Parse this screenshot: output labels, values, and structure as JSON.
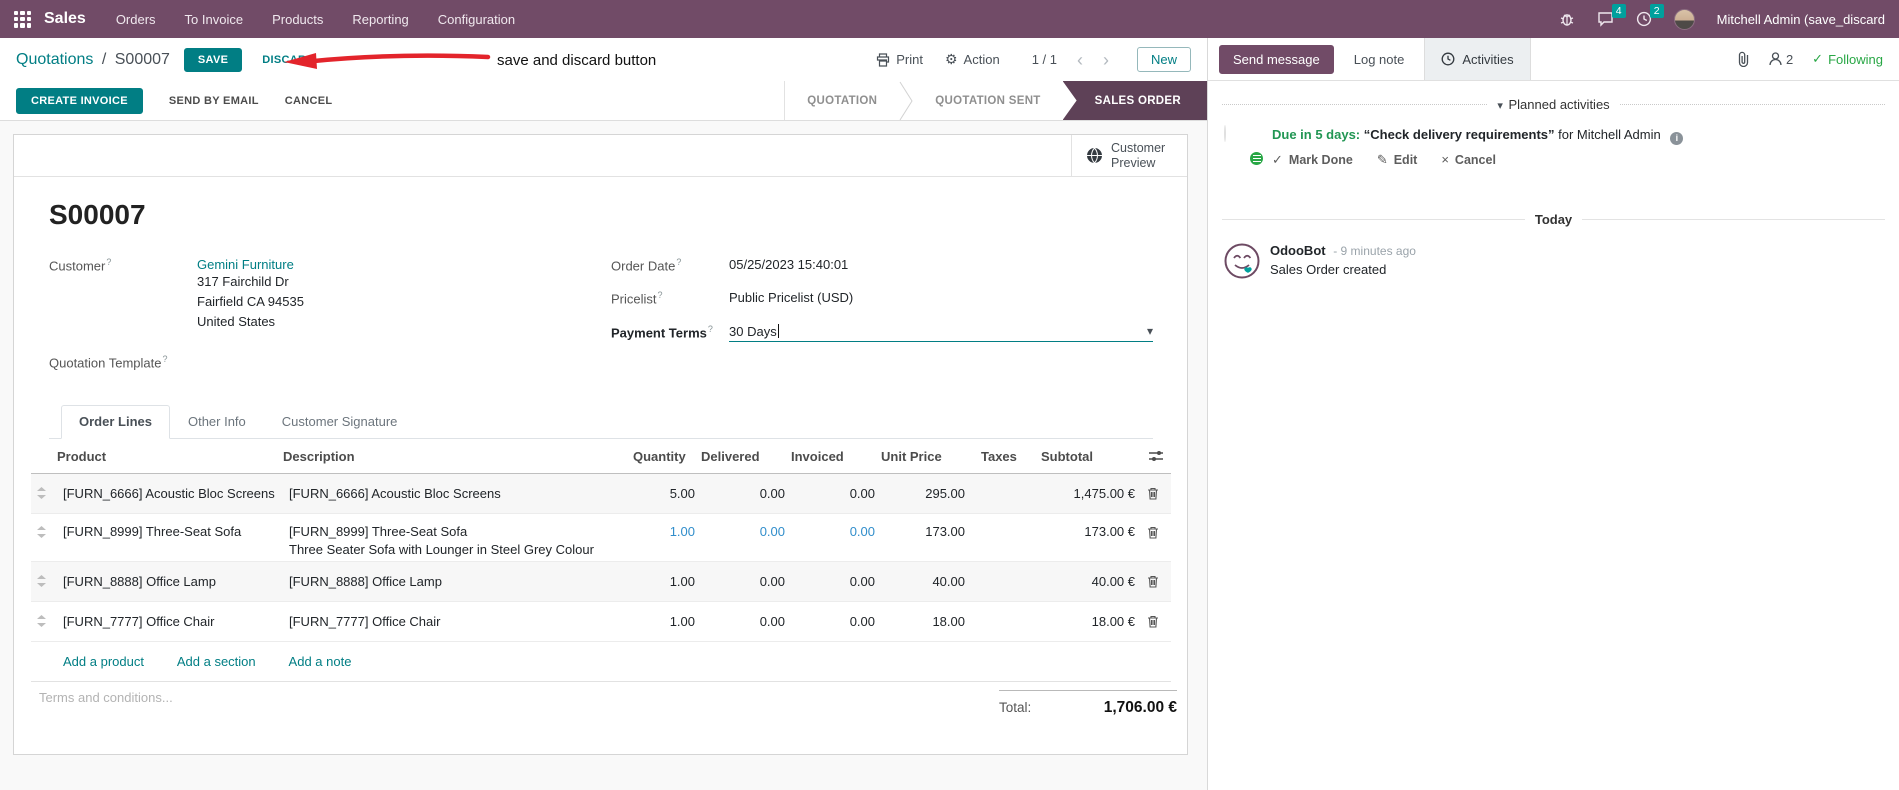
{
  "ui": {
    "help_marker": "?"
  },
  "glyphs": {
    "gear": "⚙",
    "caret_down": "▾",
    "chevron_prev": "‹",
    "chevron_next": "›",
    "check": "✓",
    "cross": "×",
    "pencil": "✎"
  },
  "colors": {
    "brand": "#714B67",
    "accent": "#017e84",
    "badge_teal": "#00a09d",
    "state_active": "#5e4157",
    "success": "#28a745",
    "highlight_blue": "#318ecb",
    "arrow_red": "#e3242b"
  },
  "navbar": {
    "app_menu_label": "Sales",
    "items": [
      "Orders",
      "To Invoice",
      "Products",
      "Reporting",
      "Configuration"
    ],
    "messages_badge": "4",
    "activities_badge": "2",
    "user_name": "Mitchell Admin (save_discard"
  },
  "breadcrumb": {
    "parent": "Quotations",
    "separator": "/",
    "current": "S00007"
  },
  "actions": {
    "save": "SAVE",
    "discard": "DISCARD",
    "print": "Print",
    "action": "Action",
    "pager": "1 / 1",
    "new": "New"
  },
  "annotation": {
    "text": "save and discard button"
  },
  "statusbar": {
    "create_invoice": "CREATE INVOICE",
    "send_by_email": "SEND BY EMAIL",
    "cancel": "CANCEL",
    "states": [
      {
        "label": "QUOTATION"
      },
      {
        "label": "QUOTATION SENT"
      },
      {
        "label": "SALES ORDER"
      }
    ]
  },
  "sheet": {
    "customer_preview": "Customer Preview",
    "title": "S00007",
    "customer_label": "Customer",
    "customer_name": "Gemini Furniture",
    "customer_address": [
      "317 Fairchild Dr",
      "Fairfield CA 94535",
      "United States"
    ],
    "quotation_template_label": "Quotation Template",
    "order_date_label": "Order Date",
    "order_date": "05/25/2023 15:40:01",
    "pricelist_label": "Pricelist",
    "pricelist": "Public Pricelist (USD)",
    "payment_terms_label": "Payment Terms",
    "payment_terms": "30 Days",
    "tabs": [
      "Order Lines",
      "Other Info",
      "Customer Signature"
    ],
    "table": {
      "headers": {
        "product": "Product",
        "description": "Description",
        "quantity": "Quantity",
        "delivered": "Delivered",
        "invoiced": "Invoiced",
        "unit_price": "Unit Price",
        "taxes": "Taxes",
        "subtotal": "Subtotal"
      },
      "rows": [
        {
          "product": "[FURN_6666] Acoustic Bloc Screens",
          "desc1": "[FURN_6666] Acoustic Bloc Screens",
          "quantity": "5.00",
          "delivered": "0.00",
          "invoiced": "0.00",
          "unit_price": "295.00",
          "subtotal": "1,475.00 €"
        },
        {
          "product": "[FURN_8999] Three-Seat Sofa",
          "desc1": "[FURN_8999] Three-Seat Sofa",
          "desc2": "Three Seater Sofa with Lounger in Steel Grey Colour",
          "quantity": "1.00",
          "delivered": "0.00",
          "invoiced": "0.00",
          "unit_price": "173.00",
          "subtotal": "173.00 €"
        },
        {
          "product": "[FURN_8888] Office Lamp",
          "desc1": "[FURN_8888] Office Lamp",
          "quantity": "1.00",
          "delivered": "0.00",
          "invoiced": "0.00",
          "unit_price": "40.00",
          "subtotal": "40.00 €"
        },
        {
          "product": "[FURN_7777] Office Chair",
          "desc1": "[FURN_7777] Office Chair",
          "quantity": "1.00",
          "delivered": "0.00",
          "invoiced": "0.00",
          "unit_price": "18.00",
          "subtotal": "18.00 €"
        }
      ],
      "add_product": "Add a product",
      "add_section": "Add a section",
      "add_note": "Add a note"
    },
    "terms_placeholder": "Terms and conditions...",
    "total_label": "Total:",
    "total_value": "1,706.00 €"
  },
  "chatter": {
    "send_message": "Send message",
    "log_note": "Log note",
    "activities": "Activities",
    "followers_count": "2",
    "following": "Following",
    "planned_activities": "Planned activities",
    "activity": {
      "due": "Due in 5 days:",
      "title": "“Check delivery requirements”",
      "assignee": "for Mitchell Admin",
      "mark_done": "Mark Done",
      "edit": "Edit",
      "cancel": "Cancel"
    },
    "today": "Today",
    "message": {
      "author": "OdooBot",
      "time": "- 9 minutes ago",
      "body": "Sales Order created"
    }
  }
}
